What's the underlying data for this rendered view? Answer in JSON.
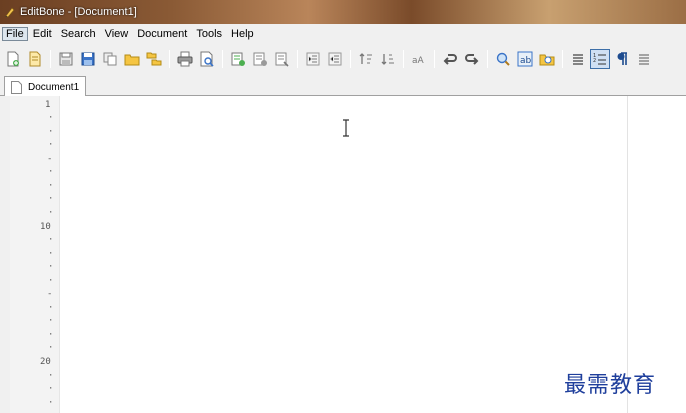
{
  "window": {
    "title": "EditBone - [Document1]"
  },
  "menu": {
    "items": [
      {
        "label": "File",
        "active": true
      },
      {
        "label": "Edit"
      },
      {
        "label": "Search"
      },
      {
        "label": "View"
      },
      {
        "label": "Document"
      },
      {
        "label": "Tools"
      },
      {
        "label": "Help"
      }
    ]
  },
  "toolbar": {
    "buttons": [
      "new-file-icon",
      "open-file-icon",
      "save-icon",
      "save-all-icon",
      "copy-icon",
      "open-folder-icon",
      "folder-tree-icon",
      "print-icon",
      "print-preview-icon",
      "compare-icon",
      "compare-files-icon",
      "compare-dirs-icon",
      "indent-icon",
      "outdent-icon",
      "sort-asc-icon",
      "sort-desc-icon",
      "case-icon",
      "undo-icon",
      "redo-icon",
      "search-icon",
      "replace-icon",
      "find-in-files-icon",
      "word-wrap-icon",
      "line-numbers-icon",
      "pilcrow-icon",
      "special-chars-icon"
    ]
  },
  "tabs": [
    {
      "label": "Document1"
    }
  ],
  "editor": {
    "gutter": {
      "labels": [
        {
          "line": 1,
          "text": "1"
        },
        {
          "line": 10,
          "text": "10"
        },
        {
          "line": 20,
          "text": "20"
        }
      ]
    }
  },
  "watermark": {
    "text": "最需教育"
  },
  "colors": {
    "accent": "#3d6fa8",
    "watermark": "#1f3f9c"
  }
}
